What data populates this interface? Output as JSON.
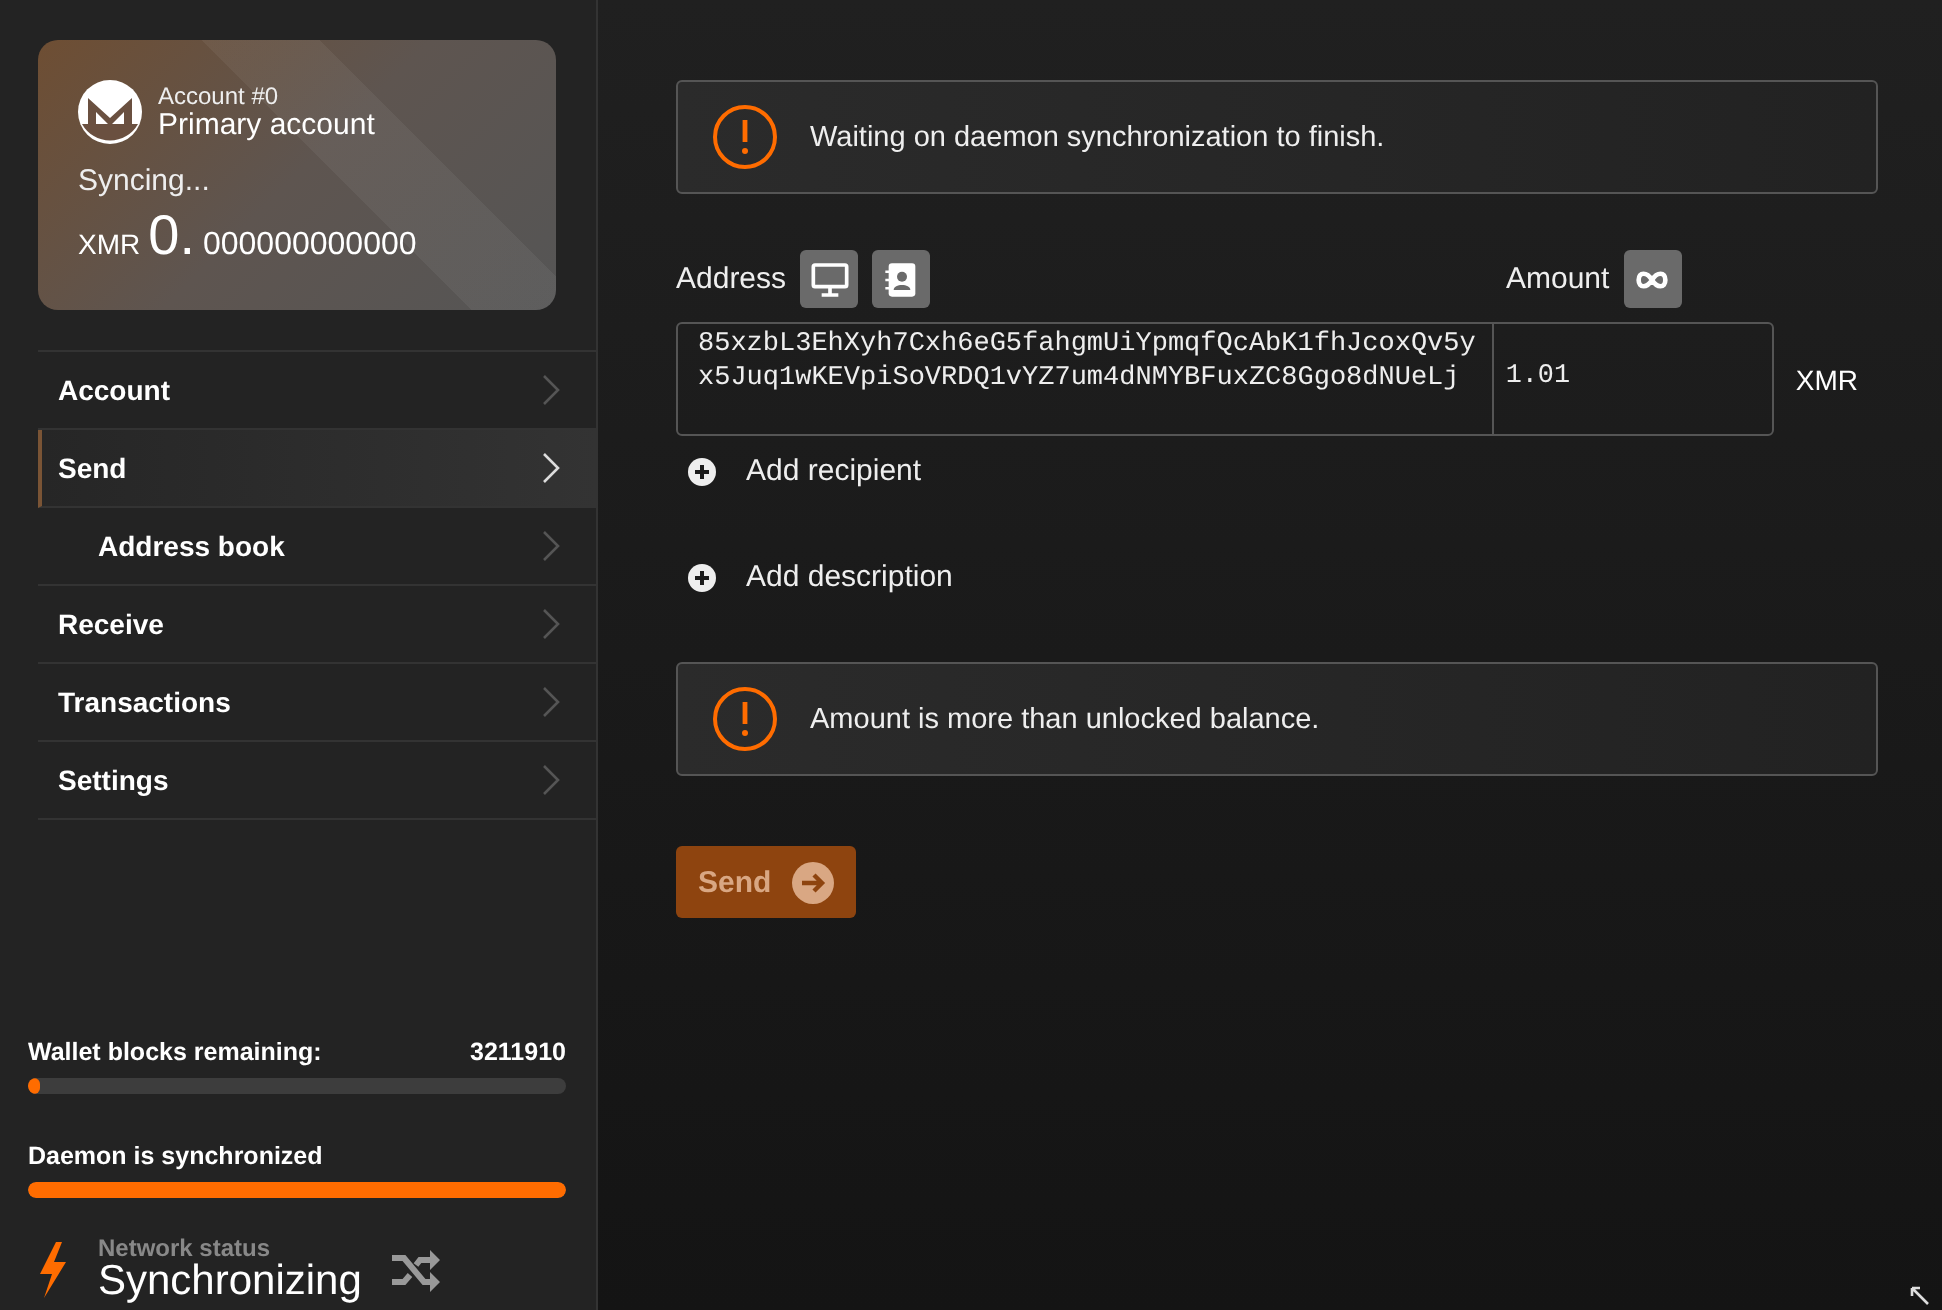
{
  "account_card": {
    "account_label": "Account #0",
    "account_name": "Primary account",
    "sync_status": "Syncing...",
    "currency": "XMR",
    "balance_integer": "0.",
    "balance_fraction": "000000000000"
  },
  "menu": [
    {
      "label": "Account",
      "selected": false
    },
    {
      "label": "Send",
      "selected": true,
      "children": [
        {
          "label": "Address book",
          "selected": false
        }
      ]
    },
    {
      "label": "Receive",
      "selected": false
    },
    {
      "label": "Transactions",
      "selected": false
    },
    {
      "label": "Settings",
      "selected": false
    }
  ],
  "progress": [
    {
      "label": "Wallet blocks remaining:",
      "value": "3211910",
      "level": 0.02
    },
    {
      "label": "Daemon is synchronized",
      "level": 1
    }
  ],
  "network_status": {
    "label": "Network status",
    "value": "Synchronizing"
  },
  "alerts": [
    {
      "text": "Waiting on daemon synchronization to finish."
    },
    {
      "text": "Amount is more than unlocked balance."
    }
  ],
  "form": {
    "address_label": "Address",
    "amount_label": "Amount",
    "address": "85xzbL3EhXyh7Cxh6eG5fahgmUiYpmqfQcAbK1fhJcoxQv5yx5Juq1wKEVpiSoVRDQ1vYZ7um4dNMYBFuxZC8Ggo8dNUeLj",
    "amount": "1.01",
    "currency": "XMR"
  },
  "actions": [
    {
      "label": "Add recipient"
    },
    {
      "label": "Add description"
    }
  ],
  "send_button": {
    "label": "Send",
    "disabled": true
  }
}
